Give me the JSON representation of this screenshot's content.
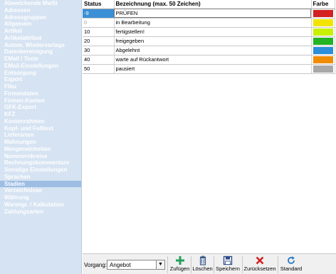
{
  "sidebar": {
    "items": [
      {
        "label": "Abweichende MwSt",
        "active": false
      },
      {
        "label": "Adressen",
        "active": false
      },
      {
        "label": "Adressgruppen",
        "active": false
      },
      {
        "label": "Allgemein",
        "active": false
      },
      {
        "label": "Artikel",
        "active": false
      },
      {
        "label": "Artikelattribut",
        "active": false
      },
      {
        "label": "Autom. Wiedervorlage",
        "active": false
      },
      {
        "label": "Datenbereinigung",
        "active": false
      },
      {
        "label": "EMail / Texte",
        "active": false
      },
      {
        "label": "EMail-Einstellungen",
        "active": false
      },
      {
        "label": "Entsorgung",
        "active": false
      },
      {
        "label": "Export",
        "active": false
      },
      {
        "label": "Fibu",
        "active": false
      },
      {
        "label": "Firmendaten",
        "active": false
      },
      {
        "label": "Firmen-Konten",
        "active": false
      },
      {
        "label": "GFK-Export",
        "active": false
      },
      {
        "label": "KFZ",
        "active": false
      },
      {
        "label": "Kontenrahmen",
        "active": false
      },
      {
        "label": "Kopf- und Fußtext",
        "active": false
      },
      {
        "label": "Lieferarten",
        "active": false
      },
      {
        "label": "Mahnungen",
        "active": false
      },
      {
        "label": "Mengeneinheiten",
        "active": false
      },
      {
        "label": "Nummernkreise",
        "active": false
      },
      {
        "label": "Rechnungskommentare",
        "active": false
      },
      {
        "label": "Sonstige Einstellungen",
        "active": false
      },
      {
        "label": "Sprachen",
        "active": false
      },
      {
        "label": "Stadien",
        "active": true
      },
      {
        "label": "Verzeichnisse",
        "active": false
      },
      {
        "label": "Währung",
        "active": false
      },
      {
        "label": "Warengr. / Kalkulation",
        "active": false
      },
      {
        "label": "Zahlungsarten",
        "active": false
      }
    ]
  },
  "table": {
    "headers": {
      "status": "Status",
      "bezeichnung": "Bezeichnung (max. 50 Zeichen)",
      "farbe": "Farbe"
    },
    "rows": [
      {
        "status": "-9",
        "bezeichnung": "PRÜFEN",
        "color": "#d42020",
        "selected": true,
        "dim": false
      },
      {
        "status": "0",
        "bezeichnung": "in Bearbeitung",
        "color": "#f2e400",
        "selected": false,
        "dim": true
      },
      {
        "status": "10",
        "bezeichnung": "fertigstellen!",
        "color": "#c8f000",
        "selected": false,
        "dim": false
      },
      {
        "status": "20",
        "bezeichnung": "freigegeben",
        "color": "#22b422",
        "selected": false,
        "dim": false
      },
      {
        "status": "30",
        "bezeichnung": "Abgelehnt",
        "color": "#2a8fd8",
        "selected": false,
        "dim": false
      },
      {
        "status": "40",
        "bezeichnung": "warte auf Rückantwort",
        "color": "#f08c00",
        "selected": false,
        "dim": false
      },
      {
        "status": "50",
        "bezeichnung": "pausiert",
        "color": "#a8a8a8",
        "selected": false,
        "dim": false
      }
    ]
  },
  "toolbar": {
    "vorgang_label": "Vorgang:",
    "vorgang_value": "Angebot",
    "buttons": {
      "add": {
        "label": "Zufügen",
        "icon": "plus-icon",
        "color": "#22a05a"
      },
      "delete": {
        "label": "Löschen",
        "icon": "trash-icon",
        "color": "#3a5a8a"
      },
      "save": {
        "label": "Speichern",
        "icon": "floppy-icon",
        "color": "#2a4a8a"
      },
      "reset": {
        "label": "Zurücksetzen",
        "icon": "x-icon",
        "color": "#d42020"
      },
      "standard": {
        "label": "Standard",
        "icon": "refresh-icon",
        "color": "#2a7ac8"
      }
    }
  }
}
